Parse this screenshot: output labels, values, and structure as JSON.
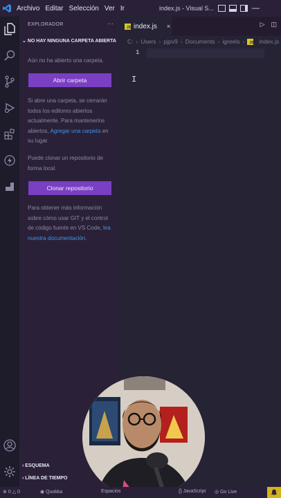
{
  "titlebar": {
    "menu": [
      "Archivo",
      "Editar",
      "Selección",
      "Ver",
      "Ir"
    ],
    "title": "index.js - Visual S..."
  },
  "sidebar": {
    "header": "EXPLORADOR",
    "more": "···",
    "section": "NO HAY NINGUNA CARPETA ABIERTA",
    "no_folder_text": "Aún no ha abierto una carpeta.",
    "open_folder_button": "Abrir carpeta",
    "close_editors_text": "Si abre una carpeta, se cerrarán todos los editores abiertos actualmente. Para mantenerlos abiertos,",
    "add_folder_link": "Agregar una carpeta",
    "close_editors_suffix": "en su lugar.",
    "clone_text": "Puede clonar un repositorio de forma local.",
    "clone_button": "Clonar repositorio",
    "git_text": "Para obtener más información sobre cómo usar GIT y el control de código fuente en VS Code,",
    "git_link": "lea nuestra documentación.",
    "outline": "ESQUEMA",
    "timeline": "LÍNEA DE TIEMPO"
  },
  "editor": {
    "tab_label": "index.js",
    "tab_close": "×",
    "breadcrumb": [
      "C:",
      "Users",
      "pjpv9",
      "Documents",
      "igreels",
      "index.js"
    ],
    "line_number": "1",
    "ibeam": "I"
  },
  "status": {
    "errors": "0",
    "warnings": "0",
    "quokka": "Quokka",
    "spaces": "Espacios",
    "language": "JavaScript",
    "golive": "Go Live"
  },
  "colors": {
    "accent_button": "#7a3fc2",
    "link": "#3d95e6",
    "bell": "#d6b21b"
  }
}
